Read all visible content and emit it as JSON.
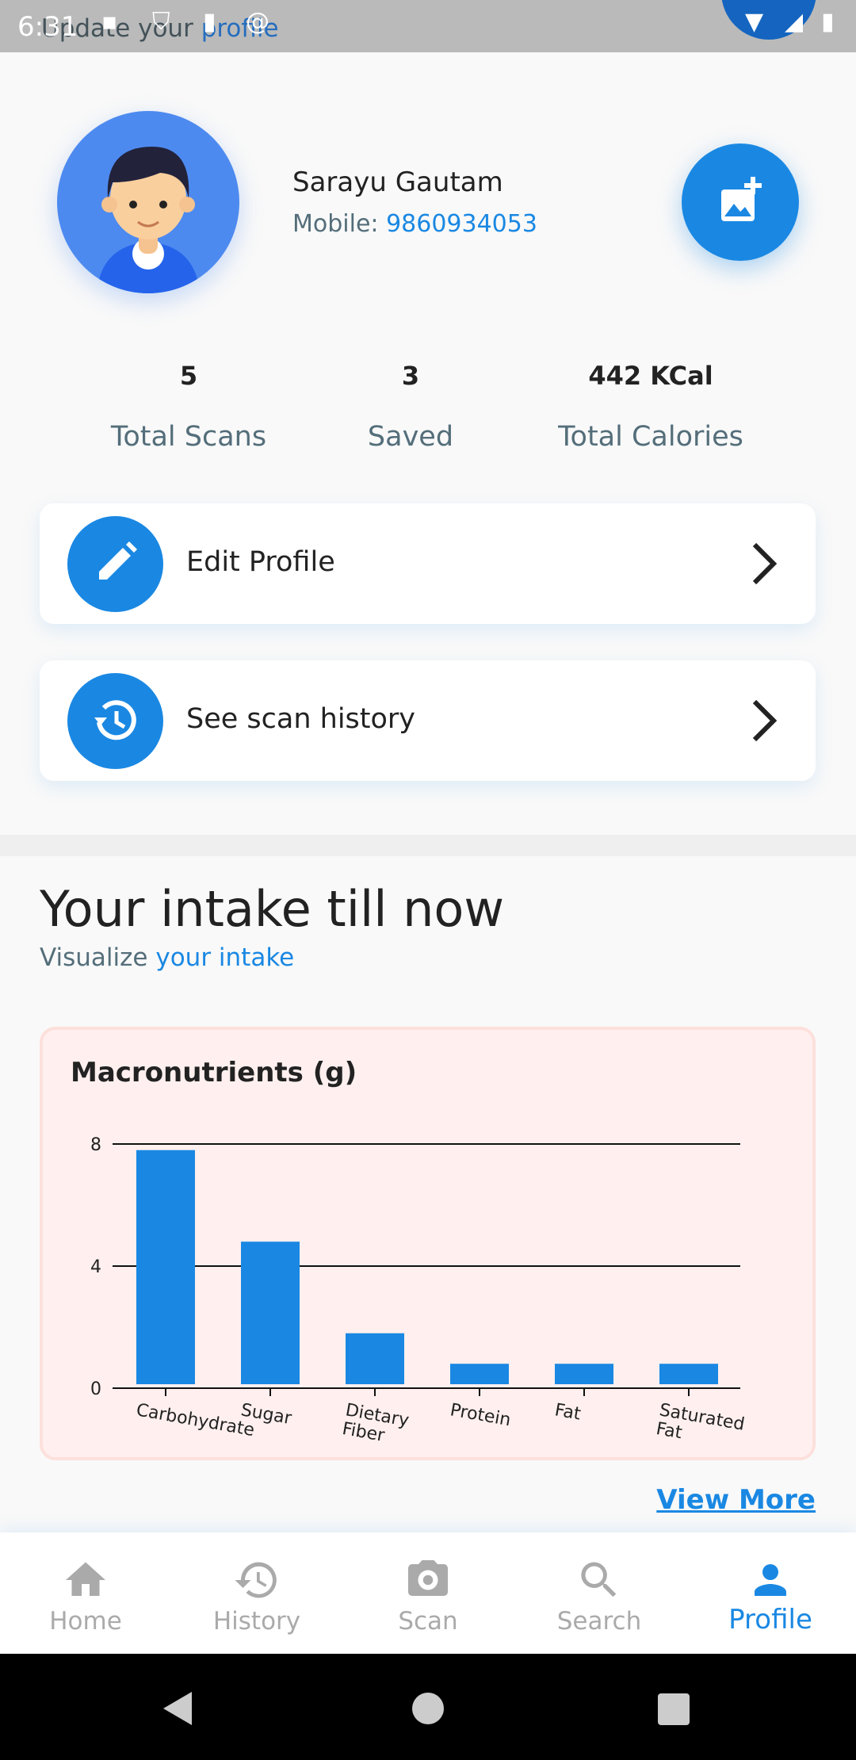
{
  "status_bar": {
    "time": "6:31",
    "overlay_text_a": "Update your ",
    "overlay_text_b": "profile"
  },
  "profile": {
    "name": "Sarayu Gautam",
    "mobile_label": "Mobile: ",
    "mobile": "9860934053"
  },
  "stats": [
    {
      "value": "5",
      "label": "Total Scans"
    },
    {
      "value": "3",
      "label": "Saved"
    },
    {
      "value": "442 KCal",
      "label": "Total Calories"
    }
  ],
  "actions": [
    {
      "label": "Edit Profile",
      "icon": "pencil-icon"
    },
    {
      "label": "See scan history",
      "icon": "history-icon"
    }
  ],
  "intake": {
    "title": "Your intake till now",
    "subtitle_a": "Visualize ",
    "subtitle_b": "your intake",
    "view_more": "View More"
  },
  "chart_data": {
    "type": "bar",
    "title": "Macronutrients (g)",
    "categories": [
      "Carbohydrate",
      "Sugar",
      "Dietary Fiber",
      "Protein",
      "Fat",
      "Saturated Fat"
    ],
    "values": [
      7.8,
      4.8,
      1.8,
      0.8,
      0.8,
      0.8
    ],
    "yticks": [
      0,
      4,
      8
    ],
    "ylim": [
      0,
      8
    ],
    "grid": true,
    "color": "#1a88e3"
  },
  "nav": [
    {
      "label": "Home",
      "icon": "home-icon"
    },
    {
      "label": "History",
      "icon": "history-icon"
    },
    {
      "label": "Scan",
      "icon": "camera-icon"
    },
    {
      "label": "Search",
      "icon": "search-icon"
    },
    {
      "label": "Profile",
      "icon": "person-icon",
      "active": true
    }
  ],
  "colors": {
    "accent": "#1a88e3",
    "avatar_bg": "#4d8af0",
    "chart_card_bg": "#fff0ef"
  }
}
